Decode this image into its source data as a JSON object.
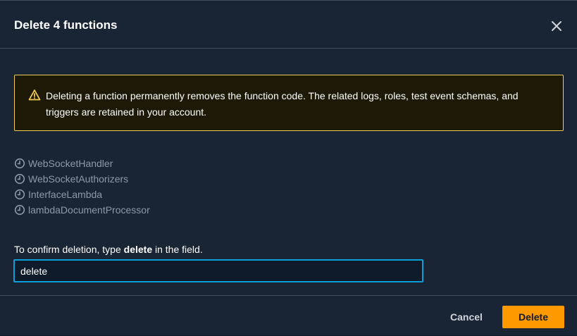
{
  "modal": {
    "title": "Delete 4 functions",
    "close_icon": "close-icon"
  },
  "alert": {
    "icon": "warning-triangle-icon",
    "text": "Deleting a function permanently removes the function code. The related logs, roles, test event schemas, and triggers are retained in your account."
  },
  "functions": [
    {
      "icon": "clock-icon",
      "name": "WebSocketHandler"
    },
    {
      "icon": "clock-icon",
      "name": "WebSocketAuthorizers"
    },
    {
      "icon": "clock-icon",
      "name": "InterfaceLambda"
    },
    {
      "icon": "clock-icon",
      "name": "lambdaDocumentProcessor"
    }
  ],
  "confirm": {
    "label_prefix": "To confirm deletion, type ",
    "label_keyword": "delete",
    "label_suffix": " in the field.",
    "value": "delete"
  },
  "footer": {
    "cancel_label": "Cancel",
    "delete_label": "Delete"
  },
  "colors": {
    "background": "#192534",
    "alert_border": "#f2cd54",
    "input_focus": "#0a9fd6",
    "primary_button": "#ff9900"
  }
}
